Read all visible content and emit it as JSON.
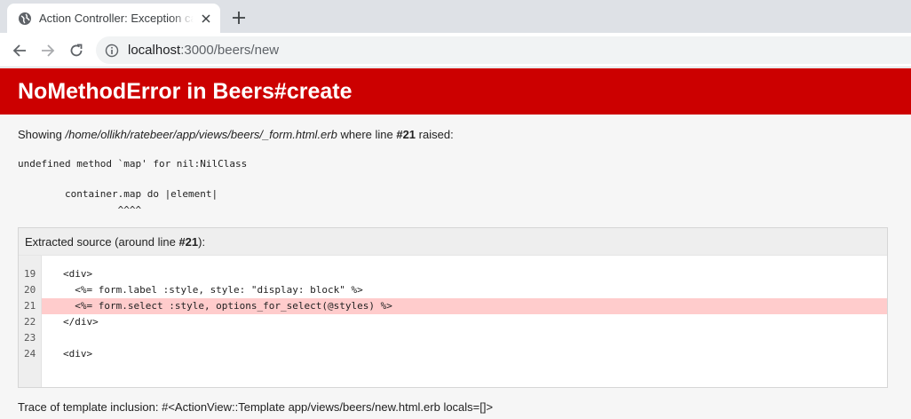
{
  "browser": {
    "tab_title": "Action Controller: Exception caught",
    "url_host": "localhost",
    "url_path": ":3000/beers/new"
  },
  "error": {
    "title": "NoMethodError in Beers#create",
    "showing_prefix": "Showing ",
    "file_path": "/home/ollikh/ratebeer/app/views/beers/_form.html.erb",
    "showing_middle": " where line ",
    "line_ref": "#21",
    "showing_suffix": " raised:",
    "message": "undefined method `map' for nil:NilClass",
    "code_context": "        container.map do |element|\n                 ^^^^"
  },
  "source": {
    "header_prefix": "Extracted source (around line ",
    "header_line": "#21",
    "header_suffix": "):",
    "lines": [
      {
        "num": "19",
        "code": "<div>",
        "highlight": false
      },
      {
        "num": "20",
        "code": "  <%= form.label :style, style: \"display: block\" %>",
        "highlight": false
      },
      {
        "num": "21",
        "code": "  <%= form.select :style, options_for_select(@styles) %>",
        "highlight": true
      },
      {
        "num": "22",
        "code": "</div>",
        "highlight": false
      },
      {
        "num": "23",
        "code": "",
        "highlight": false
      },
      {
        "num": "24",
        "code": "<div>",
        "highlight": false
      }
    ]
  },
  "trace": {
    "text": "Trace of template inclusion: #<ActionView::Template app/views/beers/new.html.erb locals=[]>"
  },
  "colors": {
    "header_bg": "#cc0000",
    "highlight_bg": "#ffcccc"
  }
}
